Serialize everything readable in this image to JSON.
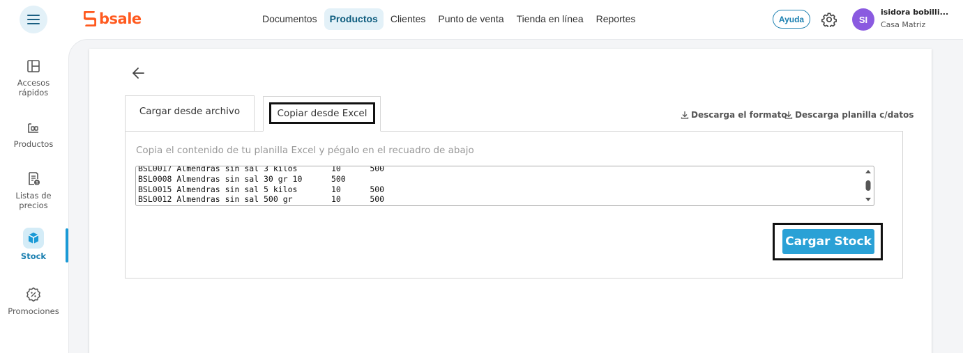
{
  "header": {
    "logo_text": "bsale",
    "nav": [
      {
        "label": "Documentos"
      },
      {
        "label": "Productos"
      },
      {
        "label": "Clientes"
      },
      {
        "label": "Punto de venta"
      },
      {
        "label": "Tienda en línea"
      },
      {
        "label": "Reportes"
      }
    ],
    "active_nav": "Productos",
    "help_label": "Ayuda",
    "avatar_initials": "SI",
    "user_name": "isidora bobilli...",
    "user_branch": "Casa Matriz"
  },
  "sidebar": {
    "items": [
      {
        "label": "Accesos\nrápidos",
        "icon": "layout-icon"
      },
      {
        "label": "Productos",
        "icon": "product-icon"
      },
      {
        "label": "Listas de\nprecios",
        "icon": "price-list-icon"
      },
      {
        "label": "Stock",
        "icon": "box-icon"
      },
      {
        "label": "Promociones",
        "icon": "percent-badge-icon"
      }
    ],
    "active": "Stock"
  },
  "main": {
    "tabs": [
      {
        "label": "Cargar desde archivo"
      },
      {
        "label": "Copiar desde Excel"
      }
    ],
    "active_tab": "Copiar desde Excel",
    "download_format_label": "Descarga el formato",
    "download_data_label": "Descarga planilla c/datos",
    "instructions": "Copia el contenido de tu planilla Excel y pégalo en el recuadro de abajo",
    "pasted_content": "BSL0017 Almendras sin sal 3 kilos       10      500\nBSL0008 Almendras sin sal 30 gr 10      500\nBSL0015 Almendras sin sal 5 kilos       10      500\nBSL0012 Almendras sin sal 500 gr        10      500",
    "submit_label": "Cargar Stock"
  },
  "colors": {
    "accent": "#2aa1d6",
    "brand": "#ff5a1f",
    "avatar": "#8a5ae0",
    "active_nav_bg": "#e3f1f8"
  }
}
